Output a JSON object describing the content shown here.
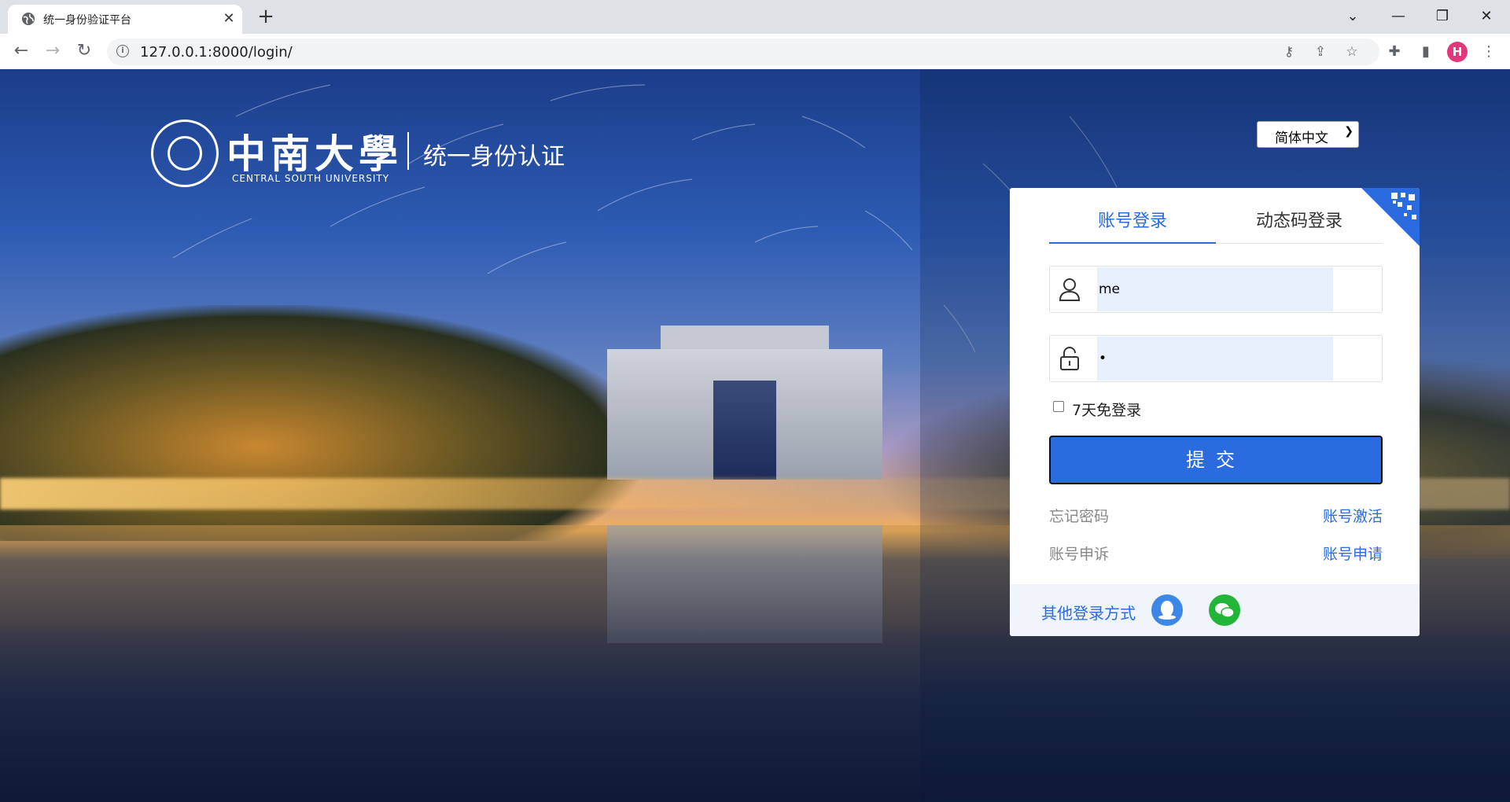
{
  "browser": {
    "tab_title": "统一身份验证平台",
    "tab_close": "✕",
    "new_tab": "+",
    "url": "127.0.0.1:8000/login/",
    "profile_initial": "H"
  },
  "logo": {
    "chinese_name": "中南大學",
    "english_name": "CENTRAL SOUTH UNIVERSITY",
    "subtitle": "统一身份认证"
  },
  "language_select": {
    "selected": "简体中文"
  },
  "login": {
    "tabs": [
      {
        "label": "账号登录",
        "active": true
      },
      {
        "label": "动态码登录",
        "active": false
      }
    ],
    "username_value": "me",
    "password_value": "•",
    "remember_label": "7天免登录",
    "remember_checked": false,
    "submit_label": "提交",
    "forgot_password": "忘记密码",
    "activate_account": "账号激活",
    "account_appeal": "账号申诉",
    "account_apply": "账号申请",
    "other_methods_label": "其他登录方式"
  },
  "colors": {
    "accent": "#2a6be0",
    "wechat": "#22b638",
    "qq": "#3d88e6",
    "avatar": "#e3377c"
  },
  "icons": [
    "globe-icon",
    "info-icon",
    "key-icon",
    "share-icon",
    "star-icon",
    "puzzle-icon",
    "sidepanel-icon",
    "menu-icon",
    "user-icon",
    "lock-icon",
    "qr-code-icon",
    "qq-icon",
    "wechat-icon"
  ]
}
